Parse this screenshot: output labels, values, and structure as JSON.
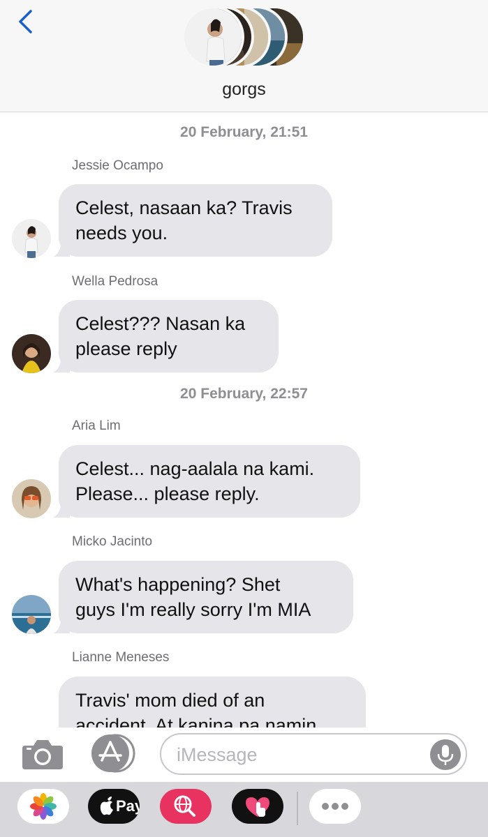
{
  "header": {
    "group_name": "gorgs"
  },
  "messages": [
    {
      "type": "timestamp",
      "text": "20 February, 21:51"
    },
    {
      "type": "message",
      "sender": "Jessie Ocampo",
      "lines": [
        "Celest, nasaan ka? Travis",
        "needs you."
      ]
    },
    {
      "type": "message",
      "sender": "Wella Pedrosa",
      "lines": [
        "Celest??? Nasan ka",
        "please reply"
      ]
    },
    {
      "type": "timestamp",
      "text": "20 February, 22:57"
    },
    {
      "type": "message",
      "sender": "Aria Lim",
      "lines": [
        "Celest... nag-aalala na kami.",
        "Please... please reply."
      ]
    },
    {
      "type": "message",
      "sender": "Micko Jacinto",
      "lines": [
        "What's happening? Shet",
        "guys I'm really sorry I'm MIA"
      ]
    },
    {
      "type": "message",
      "sender": "Lianne Meneses",
      "lines": [
        "Travis' mom died of an",
        "accident. At kanina pa namin"
      ]
    }
  ],
  "input": {
    "placeholder": "iMessage"
  },
  "app_strip": {
    "apple_pay_label": "Pay",
    "apps": [
      "photos-app",
      "apple-pay-app",
      "search-images-app",
      "digital-touch-app",
      "more-apps"
    ]
  },
  "colors": {
    "bubble": "#e5e5ea",
    "accent": "#2a6fdb",
    "timestamp": "#8e8e93"
  }
}
